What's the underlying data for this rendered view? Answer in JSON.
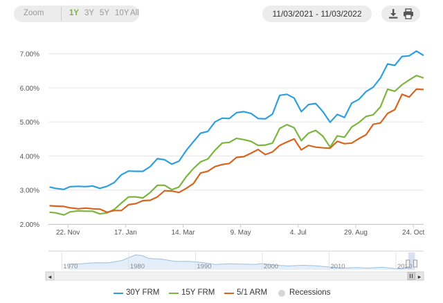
{
  "toolbar": {
    "zoom_label": "Zoom",
    "zoom_buttons": [
      "1Y",
      "3Y",
      "5Y",
      "10Y",
      "All"
    ],
    "active_zoom": "1Y",
    "date_range": "11/03/2021 - 11/03/2022",
    "download_icon": "download-icon",
    "print_icon": "print-icon"
  },
  "colors": {
    "30Y FRM": "#2d9fe0",
    "15Y FRM": "#7ab53d",
    "5/1 ARM": "#d9641e",
    "Recessions": "#d6d6d6",
    "accent": "#7cb342",
    "navigator_line": "#9ac0e2"
  },
  "legend": [
    {
      "label": "30Y FRM",
      "kind": "line"
    },
    {
      "label": "15Y FRM",
      "kind": "line"
    },
    {
      "label": "5/1 ARM",
      "kind": "line"
    },
    {
      "label": "Recessions",
      "kind": "dot"
    }
  ],
  "navigator": {
    "year_labels": [
      "1970",
      "1980",
      "1990",
      "2000",
      "2010",
      "2020"
    ],
    "left_arrow": "◂",
    "right_arrow": "▸",
    "handle_icon": "grip-icon",
    "series_30y_yearly": [
      {
        "year": 1971,
        "value": 7.5
      },
      {
        "year": 1973,
        "value": 8.0
      },
      {
        "year": 1975,
        "value": 9.0
      },
      {
        "year": 1977,
        "value": 8.9
      },
      {
        "year": 1979,
        "value": 11.2
      },
      {
        "year": 1981,
        "value": 16.6
      },
      {
        "year": 1982,
        "value": 16.0
      },
      {
        "year": 1983,
        "value": 13.2
      },
      {
        "year": 1985,
        "value": 12.4
      },
      {
        "year": 1987,
        "value": 10.2
      },
      {
        "year": 1989,
        "value": 10.3
      },
      {
        "year": 1991,
        "value": 9.2
      },
      {
        "year": 1993,
        "value": 7.3
      },
      {
        "year": 1995,
        "value": 7.9
      },
      {
        "year": 1997,
        "value": 7.6
      },
      {
        "year": 1999,
        "value": 7.4
      },
      {
        "year": 2000,
        "value": 8.1
      },
      {
        "year": 2002,
        "value": 6.5
      },
      {
        "year": 2004,
        "value": 5.8
      },
      {
        "year": 2006,
        "value": 6.4
      },
      {
        "year": 2008,
        "value": 6.0
      },
      {
        "year": 2010,
        "value": 4.7
      },
      {
        "year": 2012,
        "value": 3.7
      },
      {
        "year": 2014,
        "value": 4.2
      },
      {
        "year": 2016,
        "value": 3.7
      },
      {
        "year": 2018,
        "value": 4.5
      },
      {
        "year": 2020,
        "value": 3.1
      },
      {
        "year": 2021,
        "value": 3.0
      },
      {
        "year": 2022,
        "value": 5.3
      }
    ]
  },
  "chart_data": {
    "type": "line",
    "title": "",
    "xlabel": "",
    "ylabel": "",
    "ylim": [
      2.0,
      7.4
    ],
    "y_ticks": [
      "2.00%",
      "3.00%",
      "4.00%",
      "5.00%",
      "6.00%",
      "7.00%"
    ],
    "y_tick_values": [
      2,
      3,
      4,
      5,
      6,
      7
    ],
    "x_ticks": [
      {
        "label": "22. Nov",
        "date": "2021-11-22"
      },
      {
        "label": "17. Jan",
        "date": "2022-01-17"
      },
      {
        "label": "14. Mar",
        "date": "2022-03-14"
      },
      {
        "label": "9. May",
        "date": "2022-05-09"
      },
      {
        "label": "4. Jul",
        "date": "2022-07-04"
      },
      {
        "label": "29. Aug",
        "date": "2022-08-29"
      },
      {
        "label": "24. Oct",
        "date": "2022-10-24"
      }
    ],
    "xlim": [
      "2021-11-03",
      "2022-11-03"
    ],
    "grid": true,
    "legend_position": "bottom",
    "x": [
      "2021-11-04",
      "2021-11-10",
      "2021-11-18",
      "2021-11-24",
      "2021-12-02",
      "2021-12-09",
      "2021-12-16",
      "2021-12-23",
      "2021-12-30",
      "2022-01-06",
      "2022-01-13",
      "2022-01-20",
      "2022-01-27",
      "2022-02-03",
      "2022-02-10",
      "2022-02-17",
      "2022-02-24",
      "2022-03-03",
      "2022-03-10",
      "2022-03-17",
      "2022-03-24",
      "2022-03-31",
      "2022-04-07",
      "2022-04-14",
      "2022-04-21",
      "2022-04-28",
      "2022-05-05",
      "2022-05-12",
      "2022-05-19",
      "2022-05-26",
      "2022-06-02",
      "2022-06-09",
      "2022-06-16",
      "2022-06-23",
      "2022-06-30",
      "2022-07-07",
      "2022-07-14",
      "2022-07-21",
      "2022-07-28",
      "2022-08-04",
      "2022-08-11",
      "2022-08-18",
      "2022-08-25",
      "2022-09-01",
      "2022-09-08",
      "2022-09-15",
      "2022-09-22",
      "2022-09-29",
      "2022-10-06",
      "2022-10-13",
      "2022-10-20",
      "2022-10-27",
      "2022-11-03"
    ],
    "series": [
      {
        "name": "30Y FRM",
        "values": [
          3.09,
          3.05,
          3.02,
          3.1,
          3.11,
          3.1,
          3.12,
          3.05,
          3.11,
          3.22,
          3.45,
          3.56,
          3.55,
          3.55,
          3.69,
          3.92,
          3.89,
          3.76,
          3.85,
          4.16,
          4.42,
          4.67,
          4.72,
          5.0,
          5.11,
          5.1,
          5.27,
          5.3,
          5.25,
          5.1,
          5.09,
          5.23,
          5.78,
          5.81,
          5.7,
          5.3,
          5.51,
          5.54,
          5.3,
          4.99,
          5.22,
          5.13,
          5.55,
          5.66,
          5.89,
          6.02,
          6.29,
          6.7,
          6.66,
          6.92,
          6.94,
          7.08,
          6.95
        ]
      },
      {
        "name": "15Y FRM",
        "values": [
          2.35,
          2.33,
          2.27,
          2.36,
          2.39,
          2.38,
          2.38,
          2.3,
          2.33,
          2.43,
          2.62,
          2.8,
          2.8,
          2.77,
          2.93,
          3.14,
          3.14,
          3.01,
          3.09,
          3.39,
          3.63,
          3.83,
          3.91,
          4.17,
          4.38,
          4.4,
          4.52,
          4.48,
          4.43,
          4.31,
          4.32,
          4.38,
          4.81,
          4.92,
          4.83,
          4.45,
          4.67,
          4.75,
          4.58,
          4.26,
          4.59,
          4.55,
          4.85,
          4.98,
          5.16,
          5.21,
          5.44,
          5.96,
          5.9,
          6.09,
          6.23,
          6.36,
          6.29
        ]
      },
      {
        "name": "5/1 ARM",
        "values": [
          2.54,
          2.53,
          2.52,
          2.48,
          2.45,
          2.47,
          2.45,
          2.44,
          2.35,
          2.4,
          2.4,
          2.57,
          2.6,
          2.69,
          2.7,
          2.8,
          2.98,
          2.97,
          2.93,
          3.05,
          3.19,
          3.5,
          3.55,
          3.69,
          3.75,
          3.78,
          3.96,
          3.98,
          4.08,
          4.19,
          4.04,
          4.12,
          4.31,
          4.41,
          4.5,
          4.18,
          4.31,
          4.26,
          4.24,
          4.23,
          4.43,
          4.36,
          4.38,
          4.51,
          4.62,
          4.93,
          4.97,
          5.25,
          5.36,
          5.81,
          5.73,
          5.96,
          5.95
        ]
      }
    ]
  }
}
